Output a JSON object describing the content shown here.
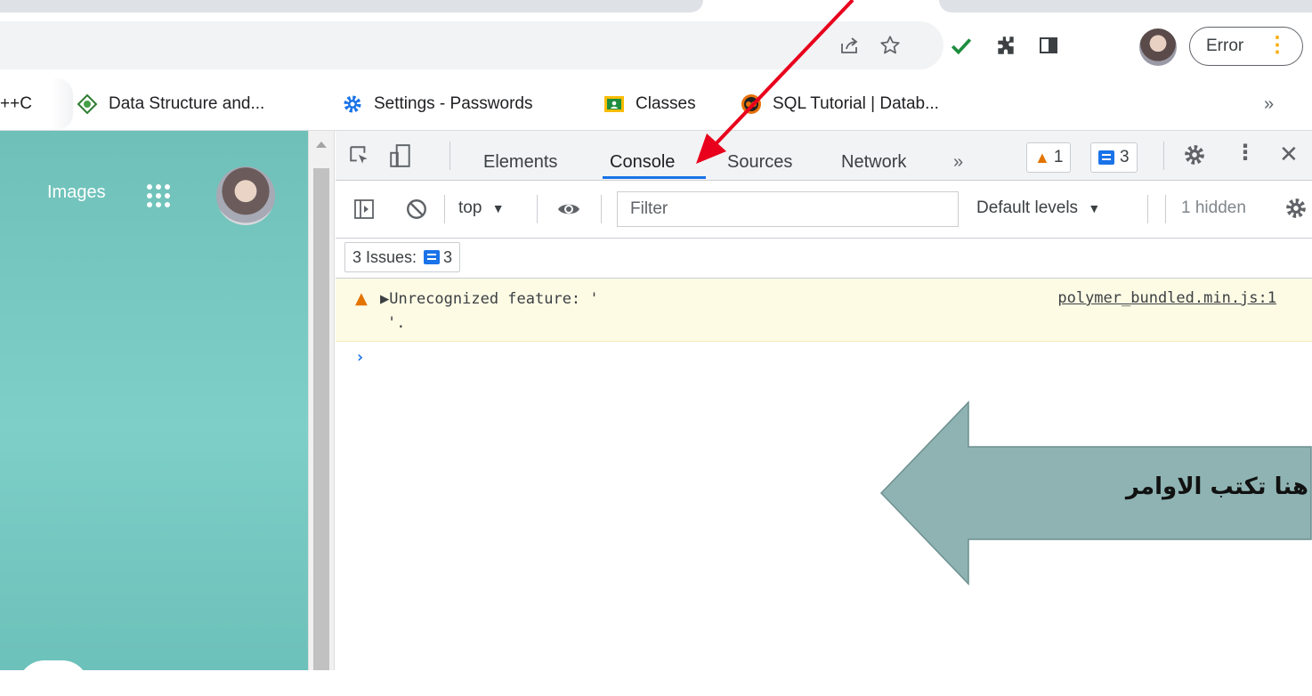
{
  "toolbar": {
    "profile_button_label": "Error",
    "icons": [
      "share-icon",
      "star-icon",
      "check-extension-icon",
      "puzzle-extensions-icon",
      "side-panel-icon",
      "profile-avatar"
    ]
  },
  "bookmarks": {
    "items": [
      {
        "label": "C++",
        "icon": "partial"
      },
      {
        "label": "Data Structure and...",
        "icon": "diamond-icon"
      },
      {
        "label": "Settings - Passwords",
        "icon": "gear-icon"
      },
      {
        "label": "Classes",
        "icon": "classroom-icon"
      },
      {
        "label": "SQL Tutorial | Datab...",
        "icon": "sql-icon"
      }
    ],
    "overflow_label": "»"
  },
  "page": {
    "images_link": "Images"
  },
  "devtools": {
    "tabs": [
      "Elements",
      "Console",
      "Sources",
      "Network"
    ],
    "active_tab": "Console",
    "more_tabs": "»",
    "warning_count": "1",
    "message_count": "3",
    "toolbar": {
      "context": "top",
      "filter_placeholder": "Filter",
      "levels": "Default levels",
      "hidden": "1 hidden"
    },
    "issues": {
      "label": "3 Issues:",
      "count": "3"
    },
    "console": {
      "warning_line1": "▶Unrecognized feature: '",
      "warning_line2": "'.",
      "warning_source": "polymer_bundled.min.js:1",
      "prompt": "›"
    }
  },
  "annotation": {
    "arrow_text": "هنا تكتب الاوامر"
  },
  "colors": {
    "teal": "#74c7bf",
    "accent": "#1a73e8",
    "warning_bg": "#fefbe5",
    "annotation_arrow": "#8fb3b3",
    "pointer_arrow": "#e8001c"
  }
}
